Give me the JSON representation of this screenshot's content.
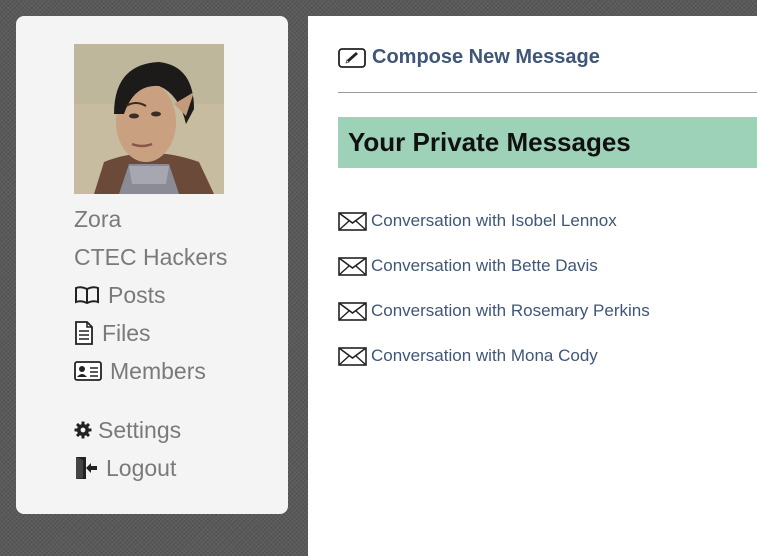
{
  "profile": {
    "name": "Zora",
    "group": "CTEC Hackers"
  },
  "nav": {
    "items": [
      {
        "label": "Posts",
        "icon": "book-icon"
      },
      {
        "label": "Files",
        "icon": "document-icon"
      },
      {
        "label": "Members",
        "icon": "id-card-icon"
      }
    ],
    "settings": {
      "label": "Settings",
      "icon": "gear-icon"
    },
    "logout": {
      "label": "Logout",
      "icon": "logout-door-icon"
    }
  },
  "main": {
    "compose_label": "Compose New Message",
    "heading": "Your Private Messages",
    "conversations": [
      {
        "label": "Conversation with Isobel Lennox"
      },
      {
        "label": "Conversation with Bette Davis"
      },
      {
        "label": "Conversation with Rosemary Perkins"
      },
      {
        "label": "Conversation with Mona Cody"
      }
    ]
  },
  "colors": {
    "banner": "#9ed2b8",
    "link": "#3f5677",
    "sidebar_text": "#7a7a7a",
    "sidebar_bg": "#f4f4f4"
  }
}
